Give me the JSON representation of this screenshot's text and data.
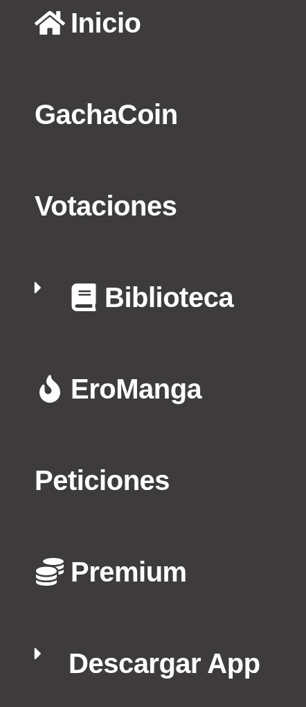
{
  "menu": {
    "items": [
      {
        "label": "Inicio",
        "kind": "link"
      },
      {
        "label": "GachaCoin",
        "kind": "link"
      },
      {
        "label": "Votaciones",
        "kind": "link"
      },
      {
        "label": "Biblioteca",
        "kind": "group",
        "expanded": false
      },
      {
        "label": "EroManga",
        "kind": "link"
      },
      {
        "label": "Peticiones",
        "kind": "link"
      },
      {
        "label": "Premium",
        "kind": "link"
      },
      {
        "label": "Descargar App",
        "kind": "group",
        "expanded": false
      }
    ]
  }
}
